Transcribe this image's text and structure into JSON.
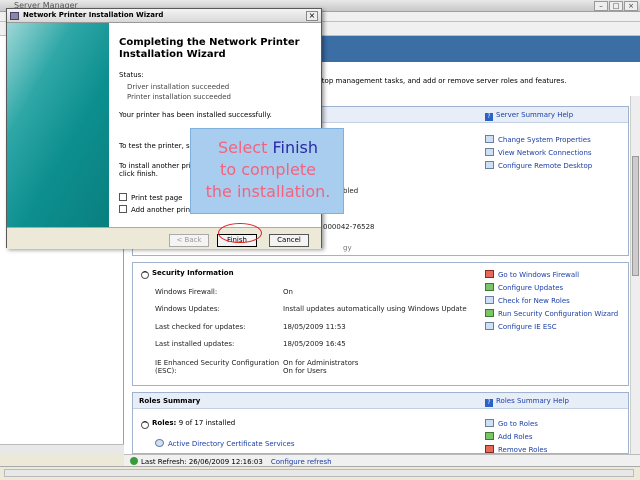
{
  "server_manager": {
    "title": "Server Manager",
    "intro": "rm top management tasks, and add or remove server roles and features.",
    "summary": {
      "help_link": "Server Summary Help",
      "tasks": [
        "Change System Properties",
        "View Network Connections",
        "Configure Remote Desktop"
      ],
      "partial_value_1": "bled",
      "partial_value_2": "000042-76528",
      "partial_value_3": "gy"
    },
    "security": {
      "title": "Security Information",
      "rows": [
        {
          "label": "Windows Firewall:",
          "value": "On"
        },
        {
          "label": "Windows Updates:",
          "value": "Install updates automatically using Windows Update"
        },
        {
          "label": "Last checked for updates:",
          "value": "18/05/2009 11:53"
        },
        {
          "label": "Last installed updates:",
          "value": "18/05/2009 16:45"
        },
        {
          "label": "IE Enhanced Security Configuration",
          "label2": "(ESC):",
          "value": "On for Administrators",
          "value2": "On for Users"
        }
      ],
      "tasks": [
        "Go to Windows Firewall",
        "Configure Updates",
        "Check for New Roles",
        "Run Security Configuration Wizard",
        "Configure IE ESC"
      ]
    },
    "roles": {
      "title": "Roles Summary",
      "help_link": "Roles Summary Help",
      "roles_count": "Roles:",
      "roles_count_value": "9 of 17 installed",
      "first_role": "Active Directory Certificate Services",
      "tasks": [
        "Go to Roles",
        "Add Roles",
        "Remove Roles"
      ]
    },
    "status": {
      "text": "Last Refresh: 26/06/2009 12:16:03",
      "link": "Configure refresh"
    }
  },
  "wizard": {
    "title": "Network Printer Installation Wizard",
    "heading_line1": "Completing the Network Printer",
    "heading_line2": "Installation Wizard",
    "status_label": "Status:",
    "status_line1": "Driver installation succeeded",
    "status_line2": "Printer installation succeeded",
    "success": "Your printer has been installed successfully.",
    "test_text": "To test the printer, select",
    "install_text_1": "To install another printer",
    "install_text_2": "click finish.",
    "checkbox_test": "Print test page",
    "checkbox_another": "Add another printer",
    "back_label": "< Back",
    "finish_label": "Finish",
    "cancel_label": "Cancel"
  },
  "callout": {
    "line1_pre": "Select ",
    "line1_em": "Finish",
    "line2": "to complete",
    "line3": "the installation."
  }
}
